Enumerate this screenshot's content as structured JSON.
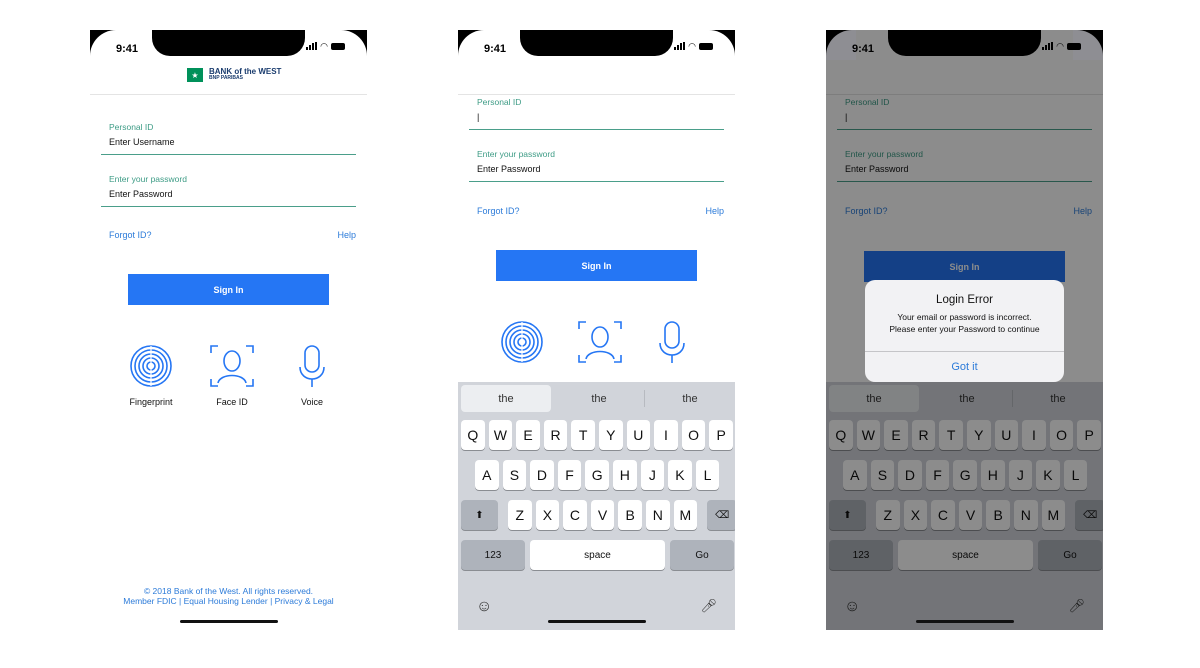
{
  "status": {
    "time": "9:41"
  },
  "brand": {
    "name": "BANK of the WEST",
    "sub": "BNP PARIBAS"
  },
  "form": {
    "personal_id_label": "Personal ID",
    "username_value": "Enter Username",
    "cursor_value": "|",
    "password_label": "Enter your password",
    "password_value": "Enter Password",
    "forgot": "Forgot ID?",
    "help": "Help",
    "signin": "Sign In"
  },
  "biometrics": [
    {
      "label": "Fingerprint",
      "icon": "fingerprint-icon"
    },
    {
      "label": "Face ID",
      "icon": "face-id-icon"
    },
    {
      "label": "Voice",
      "icon": "microphone-icon"
    }
  ],
  "footer": {
    "line1": "© 2018 Bank of the West. All rights reserved.",
    "line2": "Member FDIC | Equal Housing Lender | Privacy & Legal"
  },
  "keyboard": {
    "suggestions": [
      "the",
      "the",
      "the"
    ],
    "row1": [
      "Q",
      "W",
      "E",
      "R",
      "T",
      "Y",
      "U",
      "I",
      "O",
      "P"
    ],
    "row2": [
      "A",
      "S",
      "D",
      "F",
      "G",
      "H",
      "J",
      "K",
      "L"
    ],
    "row3": [
      "Z",
      "X",
      "C",
      "V",
      "B",
      "N",
      "M"
    ],
    "numbers": "123",
    "space": "space",
    "go": "Go"
  },
  "alert": {
    "title": "Login Error",
    "message_line1": "Your email or password is incorrect.",
    "message_line2": "Please enter your Password to continue",
    "button": "Got it"
  },
  "colors": {
    "accent": "#2576f4",
    "field_line": "#4a9e8a",
    "link": "#2c7bd9"
  }
}
